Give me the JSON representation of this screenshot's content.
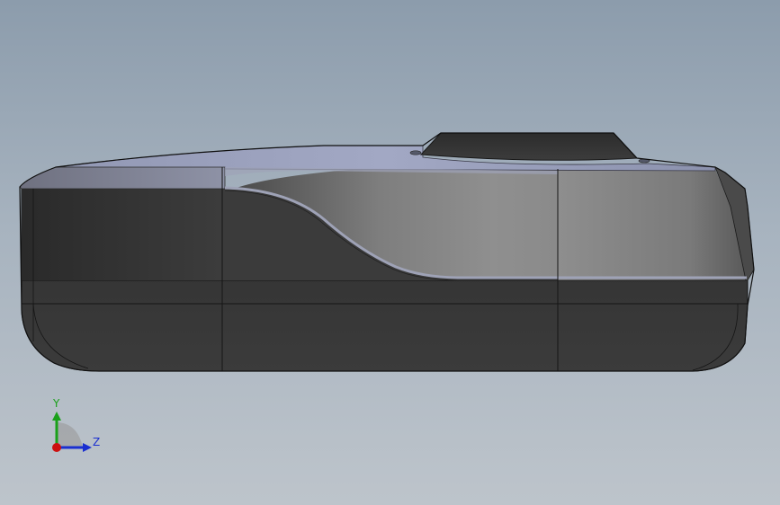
{
  "viewport": {
    "background_top": "#8c9cac",
    "background_bottom": "#bdc4cb"
  },
  "model": {
    "body_color": "#3a3a3a",
    "highlight_color": "#8a8a8a",
    "top_cover_color": "#9aa0c0"
  },
  "triad": {
    "y_label": "Y",
    "z_label": "Z",
    "y_color": "#1aa01a",
    "z_color": "#1a2fd0",
    "x_color": "#cc1010"
  }
}
